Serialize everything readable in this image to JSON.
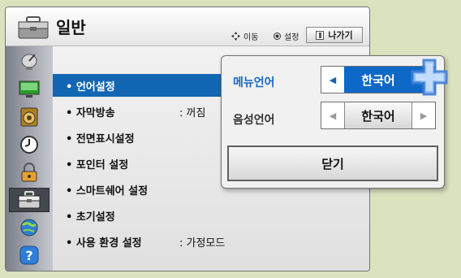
{
  "header": {
    "title": "일반",
    "hint_move": "이동",
    "hint_set": "설정",
    "exit_label": "나가기"
  },
  "sidebar": {
    "items": [
      {
        "icon": "satellite-dish-icon"
      },
      {
        "icon": "tv-picture-icon"
      },
      {
        "icon": "speaker-icon"
      },
      {
        "icon": "clock-icon"
      },
      {
        "icon": "lock-icon"
      },
      {
        "icon": "briefcase-icon",
        "active": true
      },
      {
        "icon": "network-globe-icon"
      },
      {
        "icon": "help-icon"
      }
    ]
  },
  "menu": {
    "items": [
      {
        "label": "• 언어설정",
        "value": ""
      },
      {
        "label": "• 자막방송",
        "value": ": 꺼짐"
      },
      {
        "label": "• 전면표시설정",
        "value": ""
      },
      {
        "label": "• 포인터 설정",
        "value": ""
      },
      {
        "label": "• 스마트쉐어 설정",
        "value": ""
      },
      {
        "label": "• 초기설정",
        "value": ""
      },
      {
        "label": "• 사용 환경 설정",
        "value": ": 가정모드"
      }
    ],
    "selected_index": 0
  },
  "popup": {
    "menu_language_label": "메뉴언어",
    "menu_language_value": "한국어",
    "audio_language_label": "음성언어",
    "audio_language_value": "한국어",
    "close_label": "닫기"
  },
  "colors": {
    "accent": "#1267b4",
    "background": "#dbe2be",
    "cursor": "#4a8fe0"
  }
}
